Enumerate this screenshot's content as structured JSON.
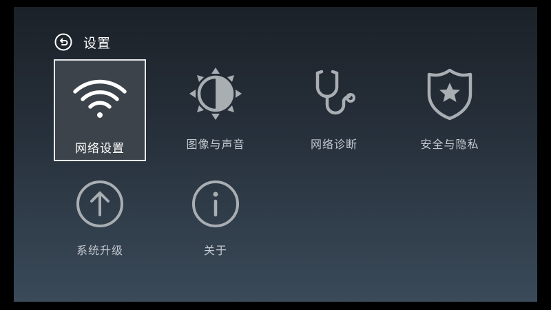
{
  "header": {
    "title": "设置",
    "back_icon": "back-arrow-circle-icon"
  },
  "tiles": [
    {
      "label": "网络设置",
      "icon": "wifi-icon",
      "selected": true
    },
    {
      "label": "图像与声音",
      "icon": "brightness-icon",
      "selected": false
    },
    {
      "label": "网络诊断",
      "icon": "stethoscope-icon",
      "selected": false
    },
    {
      "label": "安全与隐私",
      "icon": "shield-star-icon",
      "selected": false
    },
    {
      "label": "系统升级",
      "icon": "upgrade-arrow-icon",
      "selected": false
    },
    {
      "label": "关于",
      "icon": "info-icon",
      "selected": false
    }
  ],
  "colors": {
    "icon": "#a9aeb3",
    "selected_icon": "#ffffff",
    "label": "#c4c9cf",
    "selected_border": "#e6e8ea"
  }
}
